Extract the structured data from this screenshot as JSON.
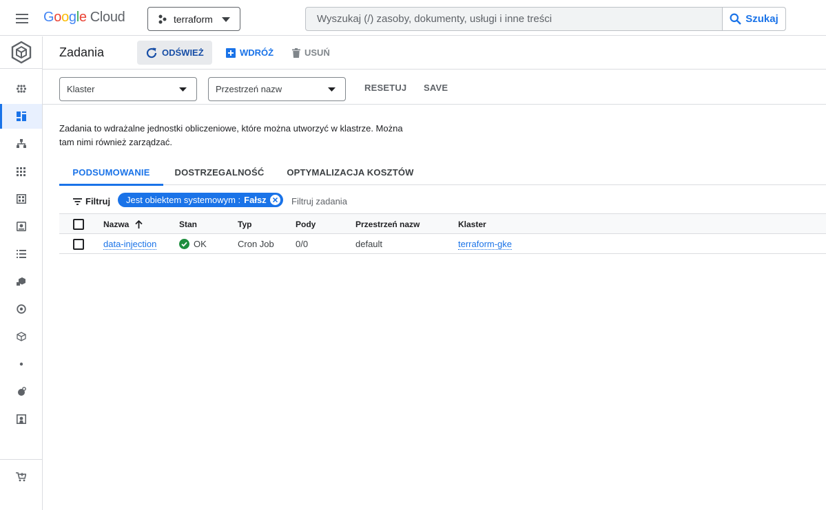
{
  "topbar": {
    "logo_google": [
      "G",
      "o",
      "o",
      "g",
      "l",
      "e"
    ],
    "logo_cloud": "Cloud",
    "project_name": "terraform",
    "search_placeholder": "Wyszukaj (/) zasoby, dokumenty, usługi i inne treści",
    "search_button": "Szukaj"
  },
  "page": {
    "title": "Zadania",
    "actions": {
      "refresh": "ODŚWIEŻ",
      "deploy": "WDRÓŻ",
      "delete": "USUŃ"
    }
  },
  "filters": {
    "cluster_placeholder": "Klaster",
    "namespace_placeholder": "Przestrzeń nazw",
    "reset": "RESETUJ",
    "save": "SAVE"
  },
  "description": "Zadania to wdrażalne jednostki obliczeniowe, które można utworzyć w klastrze. Można tam nimi również zarządzać.",
  "tabs": [
    "PODSUMOWANIE",
    "DOSTRZEGALNOŚĆ",
    "OPTYMALIZACJA KOSZTÓW"
  ],
  "filterbar": {
    "label": "Filtruj",
    "chip_key": "Jest obiektem systemowym : ",
    "chip_value": "Fałsz",
    "input_placeholder": "Filtruj zadania"
  },
  "table": {
    "headers": [
      "Nazwa",
      "Stan",
      "Typ",
      "Pody",
      "Przestrzeń nazw",
      "Klaster"
    ],
    "rows": [
      {
        "name": "data-injection",
        "status": "OK",
        "type": "Cron Job",
        "pods": "0/0",
        "namespace": "default",
        "cluster": "terraform-gke"
      }
    ]
  },
  "colors": {
    "accent": "#1a73e8",
    "ok": "#1e8e3e"
  }
}
